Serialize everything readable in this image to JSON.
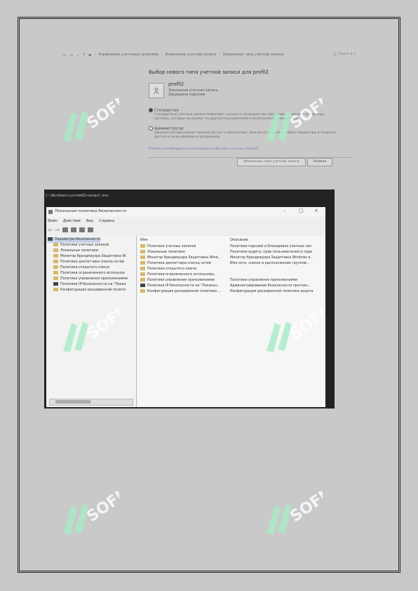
{
  "control_panel": {
    "breadcrumb": [
      "Управление учетными записями",
      "Изменение учетной записи",
      "Изменение типа учетной записи"
    ],
    "search_placeholder": "Поиск в п",
    "title": "Выбор нового типа учетной записи для profil2",
    "account": {
      "name": "profil2",
      "line1": "Локальная учетная запись",
      "line2": "Защищена паролем"
    },
    "option_standard": {
      "label": "Стандартная",
      "desc": "Стандартные учетные записи позволяют запускать большинство программ и изменять параметры системы, которые не влияют на других пользователей и безопасность компьютера."
    },
    "option_admin": {
      "label": "Администратор",
      "desc": "Администраторы имеют полный доступ к компьютеру. Они могут изменять любые параметры и получать доступ ко всем файлам и программам."
    },
    "hint": "Почему рекомендуется использовать обычные учетные записи?",
    "change_button": "Изменение типа учетной записи",
    "cancel_button": "Отмена"
  },
  "secpol": {
    "command": "C:\\Windows\\system32>secpol.msc",
    "window_title": "Локальная политика безопасности",
    "menu": [
      "Файл",
      "Действие",
      "Вид",
      "Справка"
    ],
    "tree": [
      "Параметры безопасности",
      "Политики учетных записей",
      "Локальные политики",
      "Монитор брандмауэра Защитника W",
      "Политики диспетчера списка сетей",
      "Политики открытого ключа",
      "Политики ограниченного использов",
      "Политики управления приложениями",
      "Политики IP-безопасности на \"Локал",
      "Конфигурация расширенной полити"
    ],
    "columns": {
      "name": "Имя",
      "desc": "Описание"
    },
    "rows": [
      {
        "name": "Политики учетных записей",
        "desc": "Политики паролей и блокировки учетных зап"
      },
      {
        "name": "Локальные политики",
        "desc": "Политики аудита, прав пользователей и пара"
      },
      {
        "name": "Монитор брандмауэра Защитника Wind...",
        "desc": "Монитор брандмауэра Защитника Windows в..."
      },
      {
        "name": "Политики диспетчера списка сетей",
        "desc": "Имя сети, значок и расположение группов..."
      },
      {
        "name": "Политики открытого ключа",
        "desc": ""
      },
      {
        "name": "Политики ограниченного использова...",
        "desc": ""
      },
      {
        "name": "Политики управления приложениями",
        "desc": "Политики управления приложениями"
      },
      {
        "name": "Политики IP-безопасности на \"Локальн...",
        "desc": "Администрирование безопасности протоко..."
      },
      {
        "name": "Конфигурация расширенной политики ...",
        "desc": "Конфигурация расширенной политики аудита"
      }
    ]
  },
  "watermark_text": "SOFF",
  "colors": {
    "watermark": "#ffffff",
    "watermark_green": "#a8ecc6",
    "link": "#6a7aa8"
  }
}
